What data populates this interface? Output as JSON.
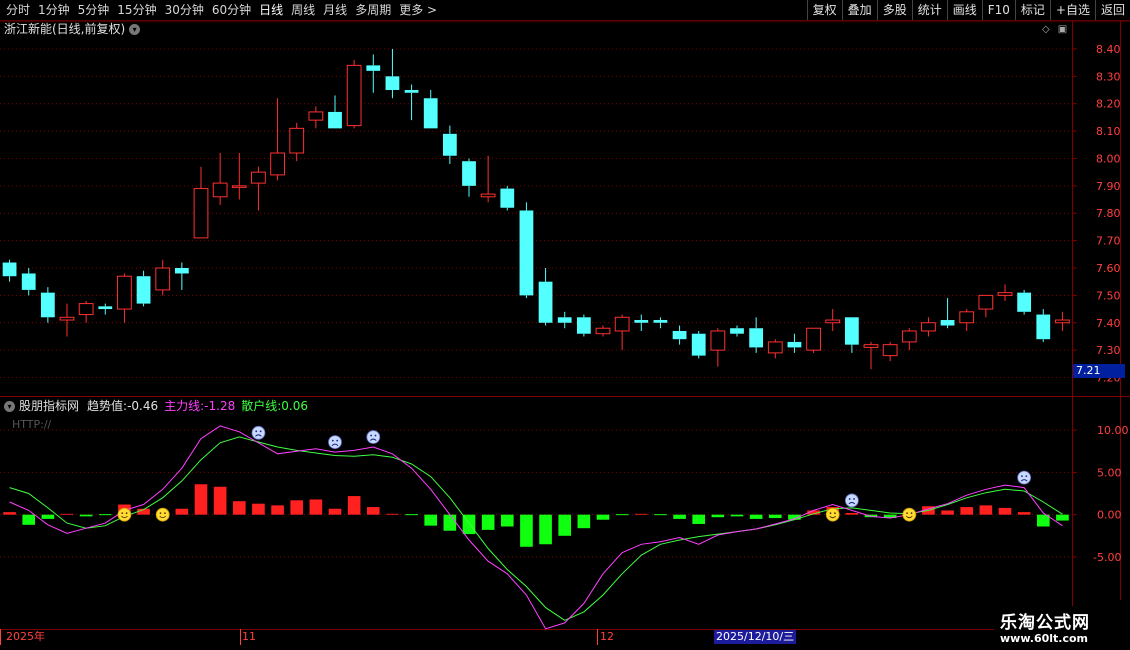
{
  "toolbar": {
    "periods": [
      "分时",
      "1分钟",
      "5分钟",
      "15分钟",
      "30分钟",
      "60分钟",
      "日线",
      "周线",
      "月线",
      "多周期",
      "更多 >"
    ],
    "active": "日线",
    "buttons": [
      "复权",
      "叠加",
      "多股",
      "统计",
      "画线",
      "F10",
      "标记",
      "+自选",
      "返回"
    ]
  },
  "chart_title": "浙江新能(日线,前复权)",
  "current_price_label": "7.21",
  "indicator": {
    "name": "股朋指标网",
    "trend_label": "趋势值:",
    "trend_value": "-0.46",
    "main_label": "主力线:",
    "main_value": "-1.28",
    "retail_label": "散户线:",
    "retail_value": "0.06",
    "watermark": "HTTP://"
  },
  "date_axis": {
    "labels": [
      "2025年",
      "11",
      "12"
    ],
    "highlight": "2025/12/10/三"
  },
  "logo": {
    "line1": "乐淘公式网",
    "line2": "www.60lt.com"
  },
  "colors": {
    "up": "#ff3030",
    "down": "#54ffff",
    "grid": "#800000",
    "main_line": "#ff40ff",
    "retail_line": "#40ff40",
    "bar_pos": "#ff2020",
    "bar_neg": "#10ff10"
  },
  "chart_data": [
    {
      "type": "candlestick",
      "y_ticks": [
        8.4,
        8.3,
        8.2,
        8.1,
        8.0,
        7.9,
        7.8,
        7.7,
        7.6,
        7.5,
        7.4,
        7.3,
        7.2
      ],
      "ylim": [
        7.18,
        8.44
      ],
      "candles": [
        [
          7.62,
          7.57,
          7.63,
          7.55
        ],
        [
          7.58,
          7.52,
          7.6,
          7.5
        ],
        [
          7.51,
          7.42,
          7.53,
          7.4
        ],
        [
          7.41,
          7.42,
          7.47,
          7.35
        ],
        [
          7.43,
          7.47,
          7.48,
          7.4
        ],
        [
          7.46,
          7.45,
          7.47,
          7.43
        ],
        [
          7.45,
          7.57,
          7.58,
          7.4
        ],
        [
          7.57,
          7.47,
          7.59,
          7.46
        ],
        [
          7.52,
          7.6,
          7.63,
          7.5
        ],
        [
          7.6,
          7.58,
          7.62,
          7.52
        ],
        [
          7.71,
          7.89,
          7.97,
          7.71
        ],
        [
          7.86,
          7.91,
          8.02,
          7.83
        ],
        [
          7.9,
          7.9,
          8.02,
          7.85
        ],
        [
          7.91,
          7.95,
          7.97,
          7.81
        ],
        [
          7.94,
          8.02,
          8.22,
          7.92
        ],
        [
          8.02,
          8.11,
          8.13,
          7.99
        ],
        [
          8.14,
          8.17,
          8.19,
          8.11
        ],
        [
          8.17,
          8.11,
          8.23,
          8.11
        ],
        [
          8.12,
          8.34,
          8.36,
          8.11
        ],
        [
          8.34,
          8.32,
          8.38,
          8.24
        ],
        [
          8.3,
          8.25,
          8.4,
          8.22
        ],
        [
          8.25,
          8.24,
          8.27,
          8.14
        ],
        [
          8.22,
          8.11,
          8.25,
          8.11
        ],
        [
          8.09,
          8.01,
          8.12,
          7.98
        ],
        [
          7.99,
          7.9,
          8.0,
          7.86
        ],
        [
          7.86,
          7.87,
          8.01,
          7.84
        ],
        [
          7.89,
          7.82,
          7.9,
          7.81
        ],
        [
          7.81,
          7.5,
          7.84,
          7.49
        ],
        [
          7.55,
          7.4,
          7.6,
          7.39
        ],
        [
          7.42,
          7.4,
          7.44,
          7.38
        ],
        [
          7.42,
          7.36,
          7.43,
          7.35
        ],
        [
          7.36,
          7.38,
          7.39,
          7.35
        ],
        [
          7.37,
          7.42,
          7.43,
          7.3
        ],
        [
          7.41,
          7.4,
          7.43,
          7.37
        ],
        [
          7.41,
          7.4,
          7.42,
          7.38
        ],
        [
          7.37,
          7.34,
          7.39,
          7.32
        ],
        [
          7.36,
          7.28,
          7.37,
          7.27
        ],
        [
          7.3,
          7.37,
          7.38,
          7.24
        ],
        [
          7.38,
          7.36,
          7.39,
          7.35
        ],
        [
          7.38,
          7.31,
          7.42,
          7.29
        ],
        [
          7.29,
          7.33,
          7.34,
          7.27
        ],
        [
          7.33,
          7.31,
          7.36,
          7.29
        ],
        [
          7.3,
          7.38,
          7.38,
          7.29
        ],
        [
          7.4,
          7.41,
          7.45,
          7.37
        ],
        [
          7.42,
          7.32,
          7.42,
          7.29
        ],
        [
          7.31,
          7.32,
          7.33,
          7.23
        ],
        [
          7.28,
          7.32,
          7.33,
          7.26
        ],
        [
          7.33,
          7.37,
          7.38,
          7.3
        ],
        [
          7.37,
          7.4,
          7.42,
          7.35
        ],
        [
          7.41,
          7.39,
          7.49,
          7.38
        ],
        [
          7.4,
          7.44,
          7.45,
          7.37
        ],
        [
          7.45,
          7.5,
          7.5,
          7.42
        ],
        [
          7.5,
          7.51,
          7.54,
          7.48
        ],
        [
          7.51,
          7.44,
          7.52,
          7.43
        ],
        [
          7.43,
          7.34,
          7.45,
          7.33
        ],
        [
          7.4,
          7.41,
          7.44,
          7.37
        ]
      ]
    },
    {
      "type": "indicator",
      "y_ticks": [
        10.0,
        5.0,
        0.0,
        -5.0
      ],
      "ylim": [
        -14,
        11.2
      ],
      "bars": [
        0.3,
        -1.2,
        -0.5,
        0.1,
        -0.2,
        0.0,
        1.2,
        0.7,
        -0.4,
        0.7,
        3.6,
        3.3,
        1.6,
        1.3,
        1.1,
        1.7,
        1.8,
        0.7,
        2.2,
        0.9,
        0.1,
        0.0,
        -1.3,
        -1.9,
        -2.3,
        -1.8,
        -1.4,
        -3.8,
        -3.5,
        -2.5,
        -1.6,
        -0.6,
        0.0,
        0.1,
        0.0,
        -0.5,
        -1.1,
        -0.3,
        -0.2,
        -0.5,
        -0.4,
        -0.6,
        0.5,
        0.9,
        0.2,
        -0.3,
        -0.4,
        0.0,
        1.0,
        0.5,
        0.9,
        1.1,
        0.8,
        0.3,
        -1.4,
        -0.7
      ],
      "main": [
        1.5,
        0.5,
        -1.2,
        -2.2,
        -1.6,
        -1.0,
        0.5,
        1.2,
        3.0,
        5.5,
        9.0,
        10.5,
        9.8,
        8.5,
        7.2,
        7.5,
        7.8,
        7.4,
        7.6,
        8.0,
        7.2,
        5.5,
        3.0,
        0.0,
        -3.0,
        -5.5,
        -7.0,
        -9.5,
        -13.5,
        -12.8,
        -10.5,
        -7.0,
        -4.5,
        -3.5,
        -3.2,
        -2.7,
        -3.5,
        -2.4,
        -2.0,
        -1.7,
        -1.1,
        -0.5,
        0.5,
        1.2,
        0.5,
        -0.2,
        -0.4,
        0.0,
        0.7,
        1.3,
        2.3,
        3.0,
        3.5,
        3.2,
        0.2,
        -1.3
      ],
      "retail": [
        3.2,
        2.5,
        0.8,
        -1.0,
        -1.6,
        -1.3,
        -0.2,
        0.6,
        2.0,
        4.0,
        6.5,
        8.5,
        9.2,
        8.6,
        8.0,
        7.6,
        7.3,
        7.0,
        6.9,
        7.1,
        6.8,
        6.0,
        4.5,
        2.0,
        -1.0,
        -4.0,
        -6.5,
        -8.5,
        -11.0,
        -12.5,
        -11.5,
        -9.5,
        -7.0,
        -4.8,
        -3.5,
        -3.0,
        -2.6,
        -2.3,
        -2.0,
        -1.7,
        -1.2,
        -0.6,
        0.1,
        0.7,
        0.8,
        0.5,
        0.2,
        0.1,
        0.5,
        1.2,
        2.0,
        2.6,
        3.0,
        2.8,
        1.5,
        0.06
      ],
      "smiles": [
        6,
        8,
        43,
        47
      ],
      "frowns": [
        13,
        17,
        19,
        44,
        53
      ]
    }
  ]
}
